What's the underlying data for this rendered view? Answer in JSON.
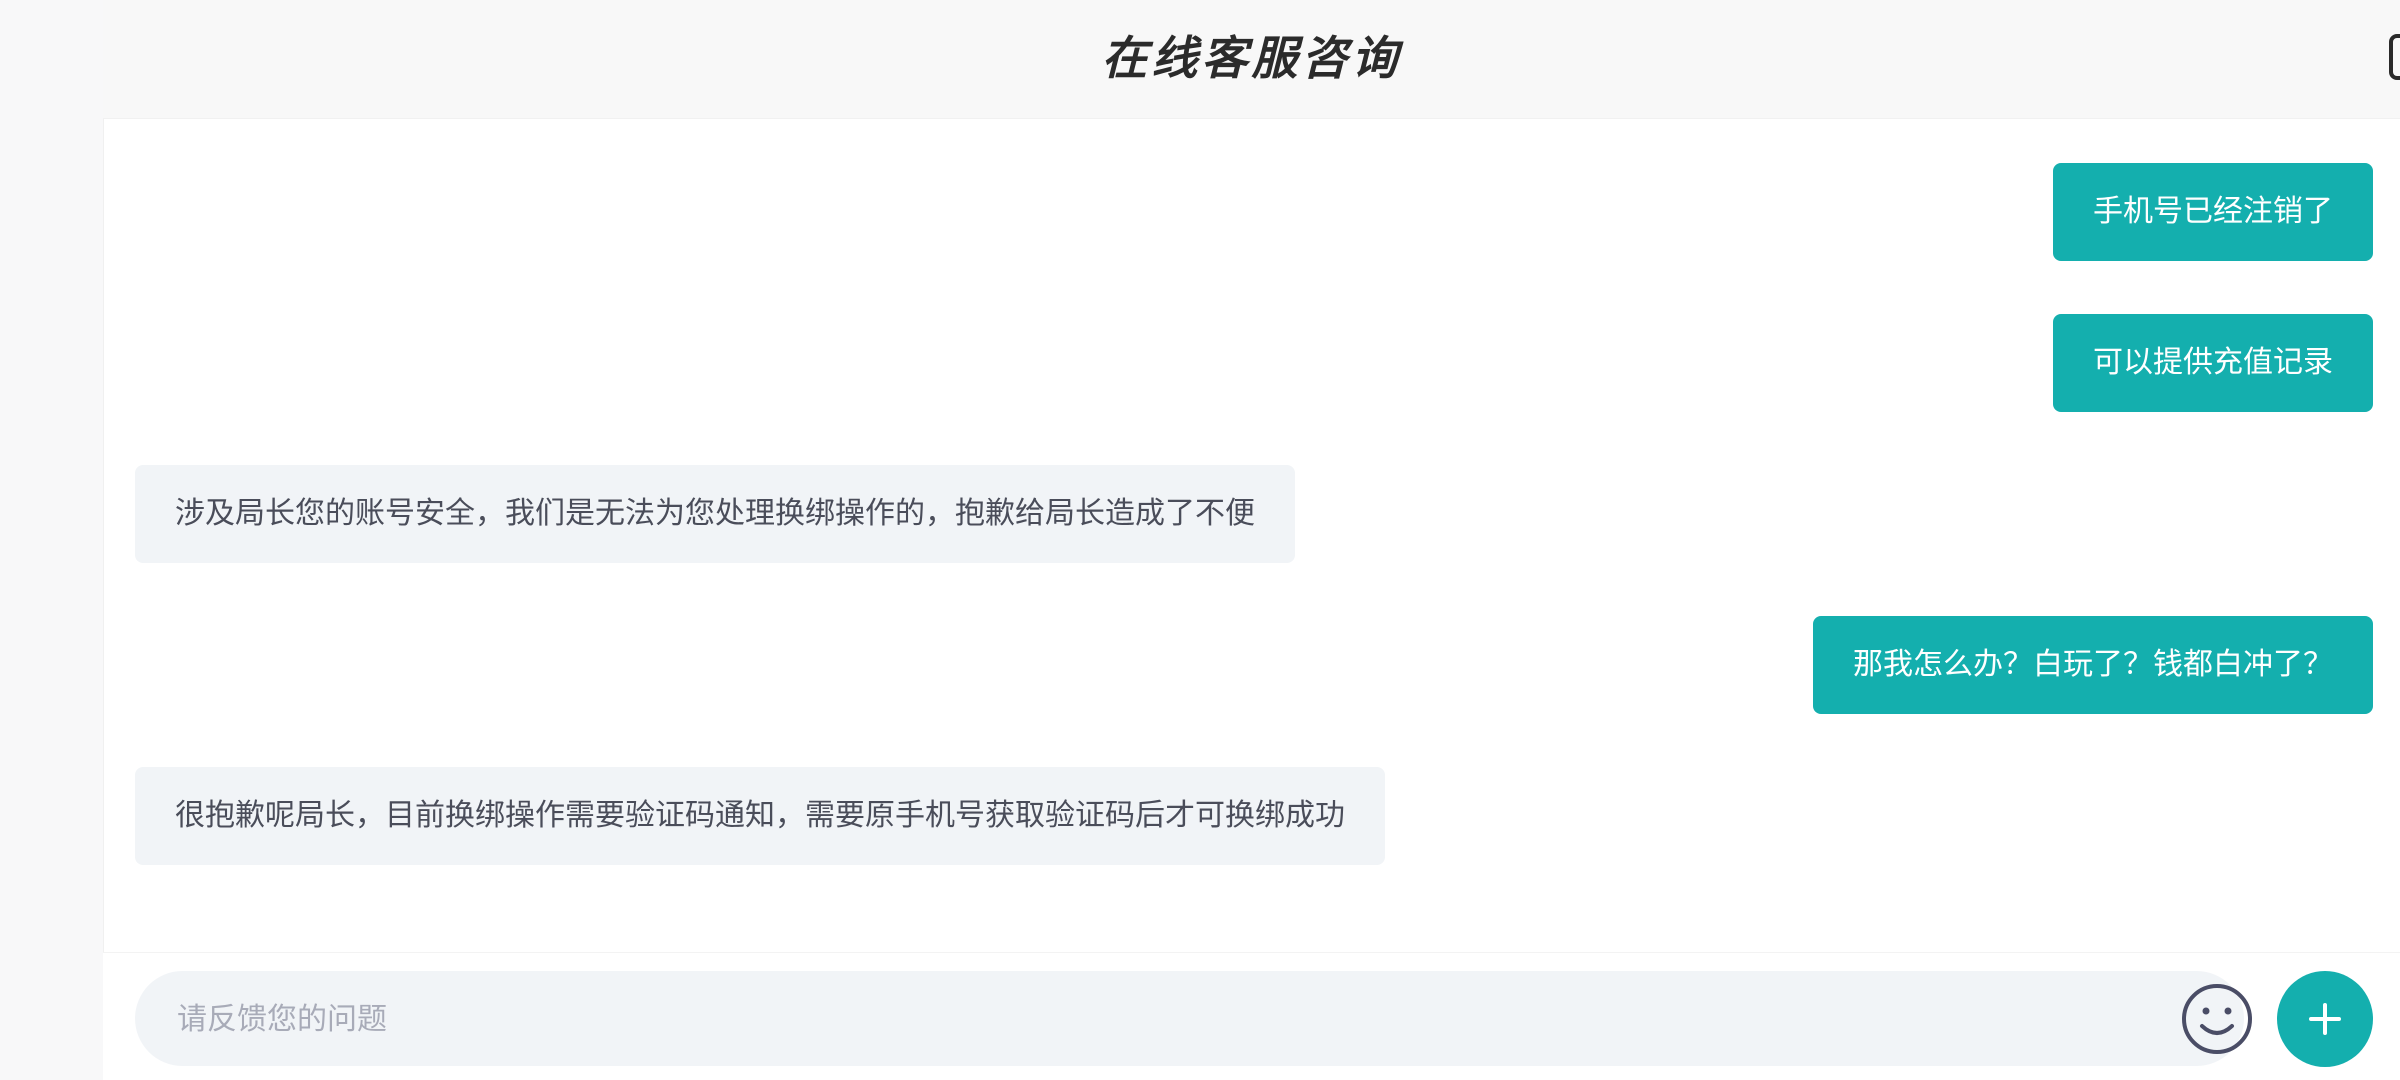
{
  "header": {
    "title": "在线客服咨询",
    "logout_icon": "logout-icon"
  },
  "messages": [
    {
      "sender": "user",
      "text": "手机号已经注销了"
    },
    {
      "sender": "user",
      "text": "可以提供充值记录"
    },
    {
      "sender": "agent",
      "text": "涉及局长您的账号安全，我们是无法为您处理换绑操作的，抱歉给局长造成了不便"
    },
    {
      "sender": "user",
      "text": "那我怎么办？白玩了？钱都白冲了？"
    },
    {
      "sender": "agent",
      "text": "很抱歉呢局长，目前换绑操作需要验证码通知，需要原手机号获取验证码后才可换绑成功"
    }
  ],
  "composer": {
    "placeholder": "请反馈您的问题",
    "value": "",
    "emoji_icon": "emoji-smile-icon",
    "plus_icon": "plus-icon"
  },
  "colors": {
    "accent": "#14afae",
    "agent_bubble": "#f1f4f7",
    "agent_text": "#4a4d5a",
    "header_bg": "#f8f8f8"
  }
}
